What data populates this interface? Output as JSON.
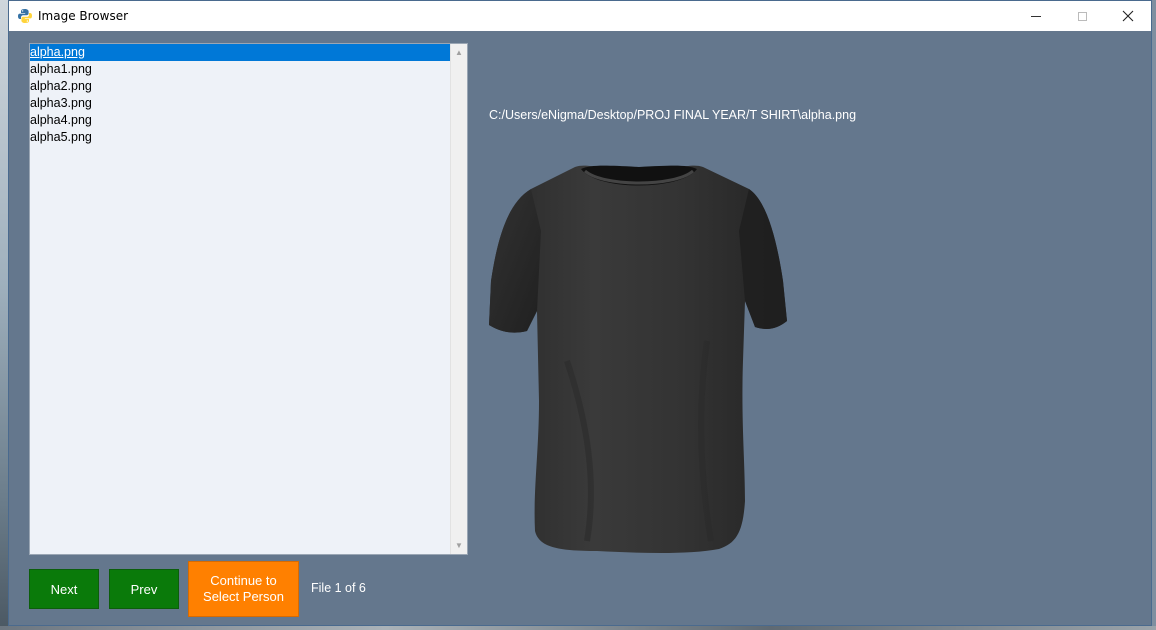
{
  "window": {
    "title": "Image Browser"
  },
  "file_list": {
    "items": [
      "alpha.png",
      "alpha1.png",
      "alpha2.png",
      "alpha3.png",
      "alpha4.png",
      "alpha5.png"
    ],
    "selected_index": 0
  },
  "preview": {
    "path": "C:/Users/eNigma/Desktop/PROJ FINAL YEAR/T SHIRT\\alpha.png"
  },
  "controls": {
    "next_label": "Next",
    "prev_label": "Prev",
    "continue_label": "Continue to Select Person",
    "file_status": "File 1 of 6"
  },
  "colors": {
    "window_bg": "#64778d",
    "next_prev_button": "#0a7a0a",
    "continue_button": "#ff8000",
    "selection": "#0078d7"
  }
}
